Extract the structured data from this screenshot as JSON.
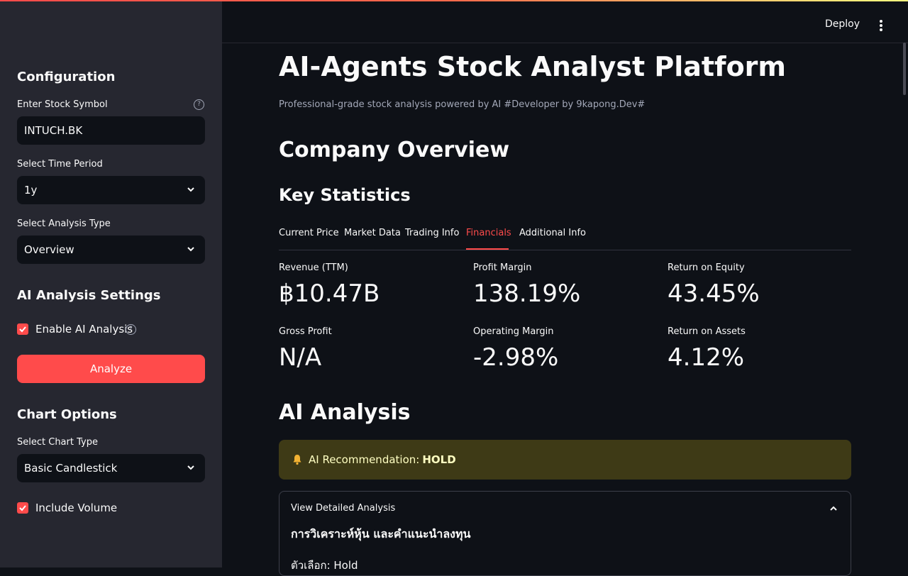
{
  "header": {
    "deploy_label": "Deploy",
    "menu_icon": "kebab-menu-icon"
  },
  "sidebar": {
    "config_title": "Configuration",
    "symbol_label": "Enter Stock Symbol",
    "symbol_value": "INTUCH.BK",
    "period_label": "Select Time Period",
    "period_value": "1y",
    "analysis_label": "Select Analysis Type",
    "analysis_value": "Overview",
    "ai_title": "AI Analysis Settings",
    "enable_ai_label": "Enable AI Analysis",
    "enable_ai_checked": true,
    "analyze_label": "Analyze",
    "chart_title": "Chart Options",
    "chart_type_label": "Select Chart Type",
    "chart_type_value": "Basic Candlestick",
    "volume_label": "Include Volume",
    "volume_checked": true
  },
  "main": {
    "title": "AI-Agents Stock Analyst Platform",
    "subtitle": "Professional-grade stock analysis powered by AI #Developer by 9kapong.Dev#",
    "overview_title": "Company Overview",
    "stats_title": "Key Statistics",
    "tabs": [
      {
        "label": "Current Price"
      },
      {
        "label": "Market Data"
      },
      {
        "label": "Trading Info"
      },
      {
        "label": "Financials"
      },
      {
        "label": "Additional Info"
      }
    ],
    "active_tab": "Financials",
    "metrics": [
      {
        "label": "Revenue (TTM)",
        "value": "฿10.47B"
      },
      {
        "label": "Profit Margin",
        "value": "138.19%"
      },
      {
        "label": "Return on Equity",
        "value": "43.45%"
      },
      {
        "label": "Gross Profit",
        "value": "N/A"
      },
      {
        "label": "Operating Margin",
        "value": "-2.98%"
      },
      {
        "label": "Return on Assets",
        "value": "4.12%"
      }
    ],
    "ai_title": "AI Analysis",
    "recommendation_label": "AI Recommendation:",
    "recommendation_value": "HOLD",
    "expander_title": "View Detailed Analysis",
    "analysis_heading": "การวิเคราะห์หุ้น และคำแนะนำลงทุน",
    "analysis_choice": "ตัวเลือก: Hold"
  },
  "colors": {
    "accent": "#ff4b4b",
    "background": "#0e1117",
    "sidebar": "#262730",
    "warning_bg": "#3e3a16"
  }
}
